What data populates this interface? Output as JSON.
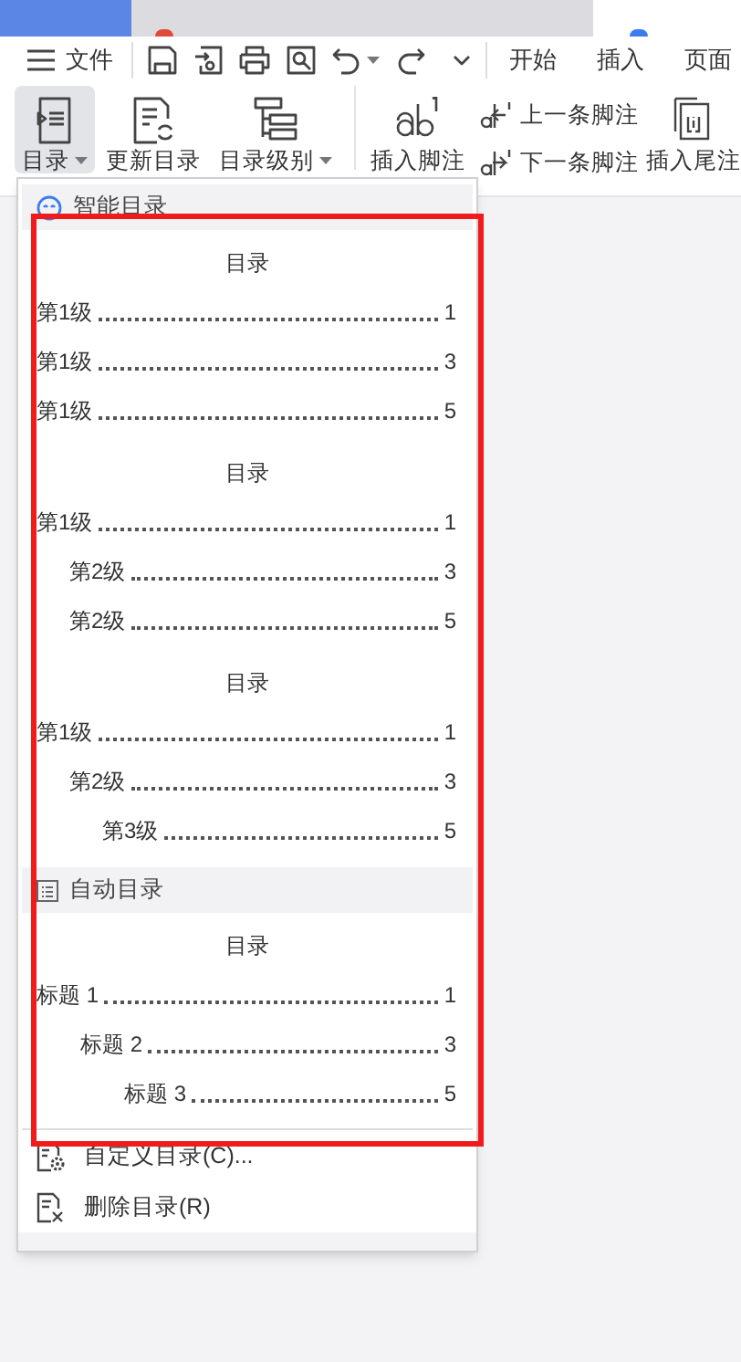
{
  "quick_bar": {
    "menu_label": "文件",
    "tabs": [
      {
        "label": "开始",
        "selected": false
      },
      {
        "label": "插入",
        "selected": false
      },
      {
        "label": "页面",
        "selected": false
      }
    ]
  },
  "ribbon": {
    "toc_buttons": [
      {
        "label": "目录",
        "dropdown": true,
        "selected": true
      },
      {
        "label": "更新目录",
        "dropdown": false,
        "selected": false
      },
      {
        "label": "目录级别",
        "dropdown": true,
        "selected": false
      }
    ],
    "insert_footnote": "插入脚注",
    "previous_footnote": "上一条脚注",
    "next_footnote": "下一条脚注",
    "insert_endnote": "插入尾注"
  },
  "menu": {
    "sections": [
      {
        "title": "智能目录",
        "kind": "smart",
        "previews": [
          {
            "title": "目录",
            "entries": [
              {
                "text": "第1级",
                "page": "1"
              },
              {
                "text": "第1级",
                "page": "3"
              },
              {
                "text": "第1级",
                "page": "5"
              }
            ]
          },
          {
            "title": "目录",
            "entries": [
              {
                "text": "第1级",
                "page": "1",
                "children": [
                  {
                    "text": "第2级",
                    "page": "3"
                  },
                  {
                    "text": "第2级",
                    "page": "5"
                  }
                ]
              }
            ]
          },
          {
            "title": "目录",
            "entries": [
              {
                "text": "第1级",
                "page": "1",
                "children": [
                  {
                    "text": "第2级",
                    "page": "3",
                    "children": [
                      {
                        "text": "第3级",
                        "page": "5"
                      }
                    ]
                  }
                ]
              }
            ]
          }
        ]
      },
      {
        "title": "自动目录",
        "kind": "auto",
        "previews": [
          {
            "title": "目录",
            "entries": [
              {
                "text": "标题 1",
                "page": "1",
                "children": [
                  {
                    "text": "标题 2",
                    "page": "3",
                    "children": [
                      {
                        "text": "标题 3",
                        "page": "5"
                      }
                    ]
                  }
                ]
              }
            ]
          }
        ]
      }
    ],
    "actions": [
      {
        "label": "自定义目录(C)...",
        "kind": "custom"
      },
      {
        "label": "删除目录(R)",
        "kind": "delete"
      }
    ]
  }
}
